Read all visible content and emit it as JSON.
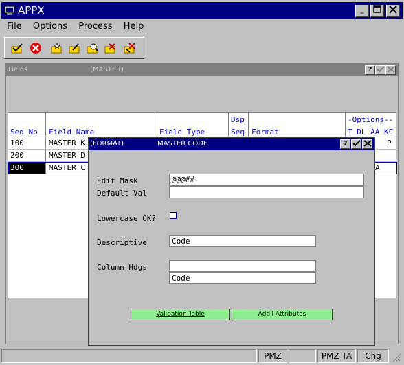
{
  "window": {
    "title": "APPX"
  },
  "menu": [
    {
      "label": "File"
    },
    {
      "label": "Options"
    },
    {
      "label": "Process"
    },
    {
      "label": "Help"
    }
  ],
  "toolbar": {
    "icons": [
      "ok-icon",
      "cancel-icon",
      "new-icon",
      "edit-icon",
      "inquire-icon",
      "delete-icon",
      "delete-all-icon"
    ]
  },
  "fields_window": {
    "title": "Fields",
    "subtitle": "(MASTER)"
  },
  "table": {
    "headers": {
      "seq": "Seq No",
      "name": "Field Name",
      "type": "Field Type",
      "dsp_top": "Dsp",
      "dsp_bottom": "Seq",
      "format": "Format",
      "options_top": "-Options--",
      "options_bottom": "T DL AA KC"
    },
    "rows": [
      {
        "seq": "100",
        "name": "MASTER K",
        "opt": "P"
      },
      {
        "seq": "200",
        "name": "MASTER D",
        "opt": ""
      },
      {
        "seq": "300",
        "name": "MASTER C",
        "opt": "A"
      }
    ]
  },
  "format_dialog": {
    "title_left": "(FORMAT)",
    "title_right": "MASTER CODE",
    "edit_mask_label": "Edit Mask",
    "edit_mask_value": "@@@##",
    "default_val_label": "Default Val",
    "default_val_value": "",
    "lowercase_label": "Lowercase OK?",
    "descriptive_label": "Descriptive",
    "descriptive_value": "Code",
    "column_hdgs_label": "Column Hdgs",
    "column_hdg1_value": "",
    "column_hdg2_value": "Code",
    "validation_button": "Validation Table",
    "attributes_button": "Add'l Attributes"
  },
  "status": {
    "cells": [
      "",
      "PMZ",
      "",
      "PMZ TA",
      "Chg"
    ]
  }
}
